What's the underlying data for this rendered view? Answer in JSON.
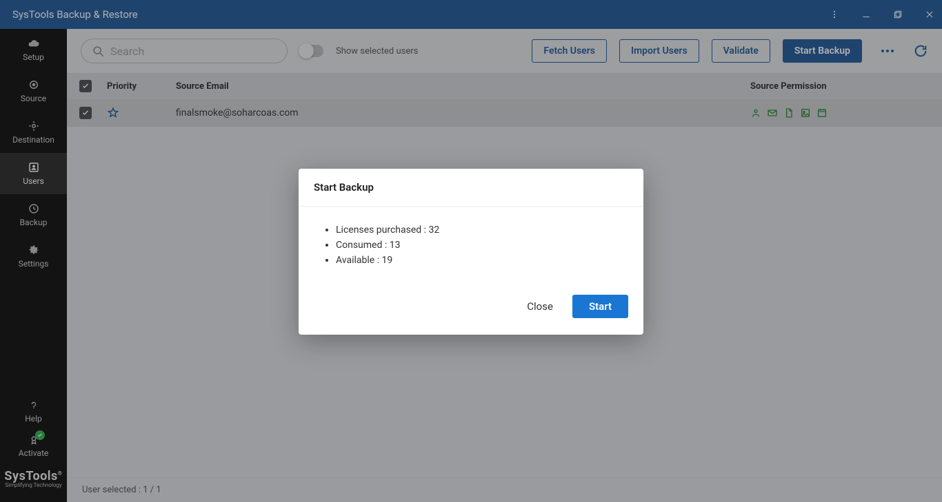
{
  "titlebar": {
    "title": "SysTools Backup & Restore"
  },
  "sidebar": {
    "items": [
      {
        "label": "Setup"
      },
      {
        "label": "Source"
      },
      {
        "label": "Destination"
      },
      {
        "label": "Users"
      },
      {
        "label": "Backup"
      },
      {
        "label": "Settings"
      }
    ],
    "footer": {
      "help": "Help",
      "activate": "Activate"
    },
    "brand": {
      "name": "SysTools",
      "tagline": "Simplifying Technology",
      "reg": "®"
    }
  },
  "toolbar": {
    "search_placeholder": "Search",
    "toggle_label": "Show selected users",
    "fetch": "Fetch Users",
    "import": "Import Users",
    "validate": "Validate",
    "start_backup": "Start Backup"
  },
  "table": {
    "headers": {
      "priority": "Priority",
      "email": "Source Email",
      "permission": "Source Permission"
    },
    "rows": [
      {
        "email": "finalsmoke@soharcoas.com"
      }
    ]
  },
  "statusbar": {
    "text": "User selected : 1 / 1"
  },
  "dialog": {
    "title": "Start Backup",
    "licenses": "Licenses purchased : 32",
    "consumed": "Consumed : 13",
    "available": "Available : 19",
    "close": "Close",
    "start": "Start"
  }
}
